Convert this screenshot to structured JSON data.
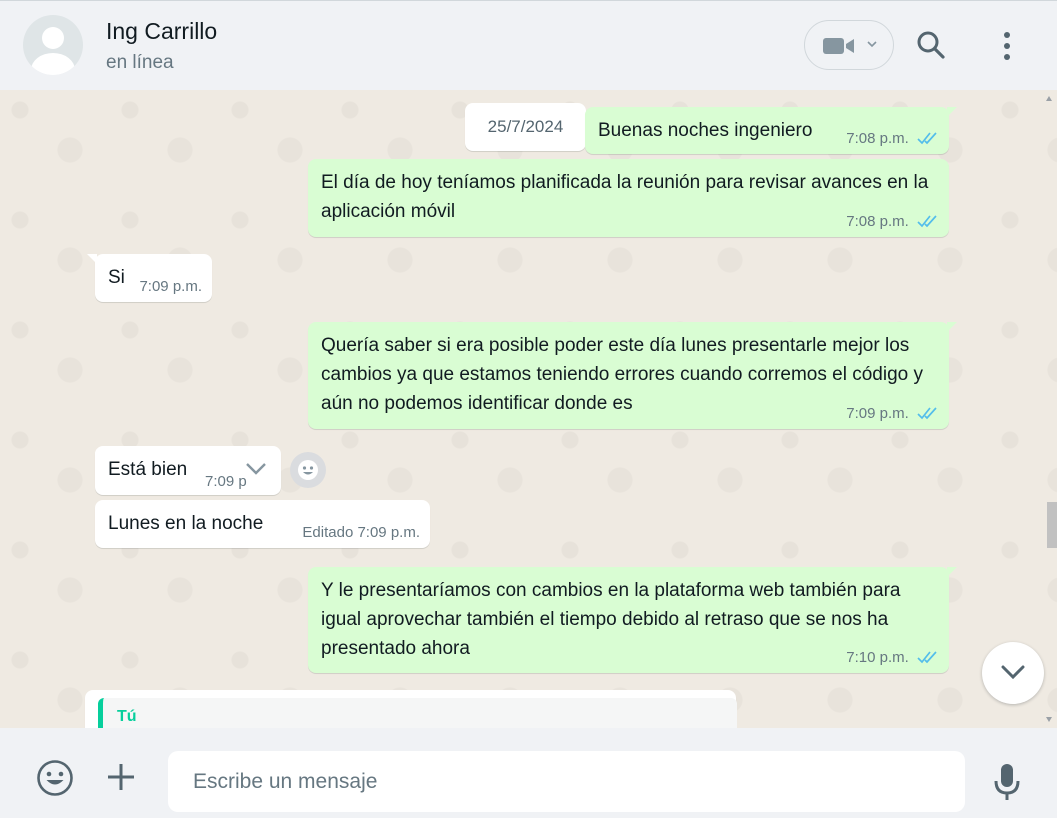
{
  "header": {
    "contact_name": "Ing Carrillo",
    "status": "en línea",
    "icons": [
      "avatar",
      "video-call-icon",
      "chevron-down-icon",
      "search-icon",
      "menu-icon"
    ]
  },
  "date_chip": "25/7/2024",
  "messages": [
    {
      "dir": "out",
      "text": "Buenas noches ingeniero",
      "time": "7:08 p.m.",
      "status": "read"
    },
    {
      "dir": "out",
      "text": "El día de hoy teníamos planificada la reunión para revisar avances en la aplicación móvil",
      "time": "7:08 p.m.",
      "status": "read"
    },
    {
      "dir": "in",
      "text": "Si",
      "time": "7:09 p.m."
    },
    {
      "dir": "out",
      "text": "Quería saber si era posible poder este día lunes presentarle mejor los cambios ya que estamos teniendo errores cuando corremos el código y aún no podemos identificar donde es",
      "time": "7:09 p.m.",
      "status": "read"
    },
    {
      "dir": "in",
      "text": "Está bien",
      "time": "7:09 p",
      "hover_menu": true
    },
    {
      "dir": "in",
      "text": "Lunes en la noche",
      "edited": "Editado",
      "time": "7:09 p.m."
    },
    {
      "dir": "out",
      "text": "Y le presentaríamos con cambios en la plataforma web también para igual aprovechar también el tiempo debido al retraso que se nos ha presentado ahora",
      "time": "7:10 p.m.",
      "status": "read"
    }
  ],
  "reply_preview": {
    "author": "Tú"
  },
  "footer": {
    "placeholder": "Escribe un mensaje",
    "value": "",
    "icons": [
      "emoji-icon",
      "plus-icon",
      "mic-icon"
    ]
  },
  "colors": {
    "outgoing_bubble": "#d9fdd3",
    "incoming_bubble": "#ffffff",
    "read_ticks": "#53bdeb",
    "accent": "#06cf9c",
    "chat_background": "#efeae2"
  }
}
